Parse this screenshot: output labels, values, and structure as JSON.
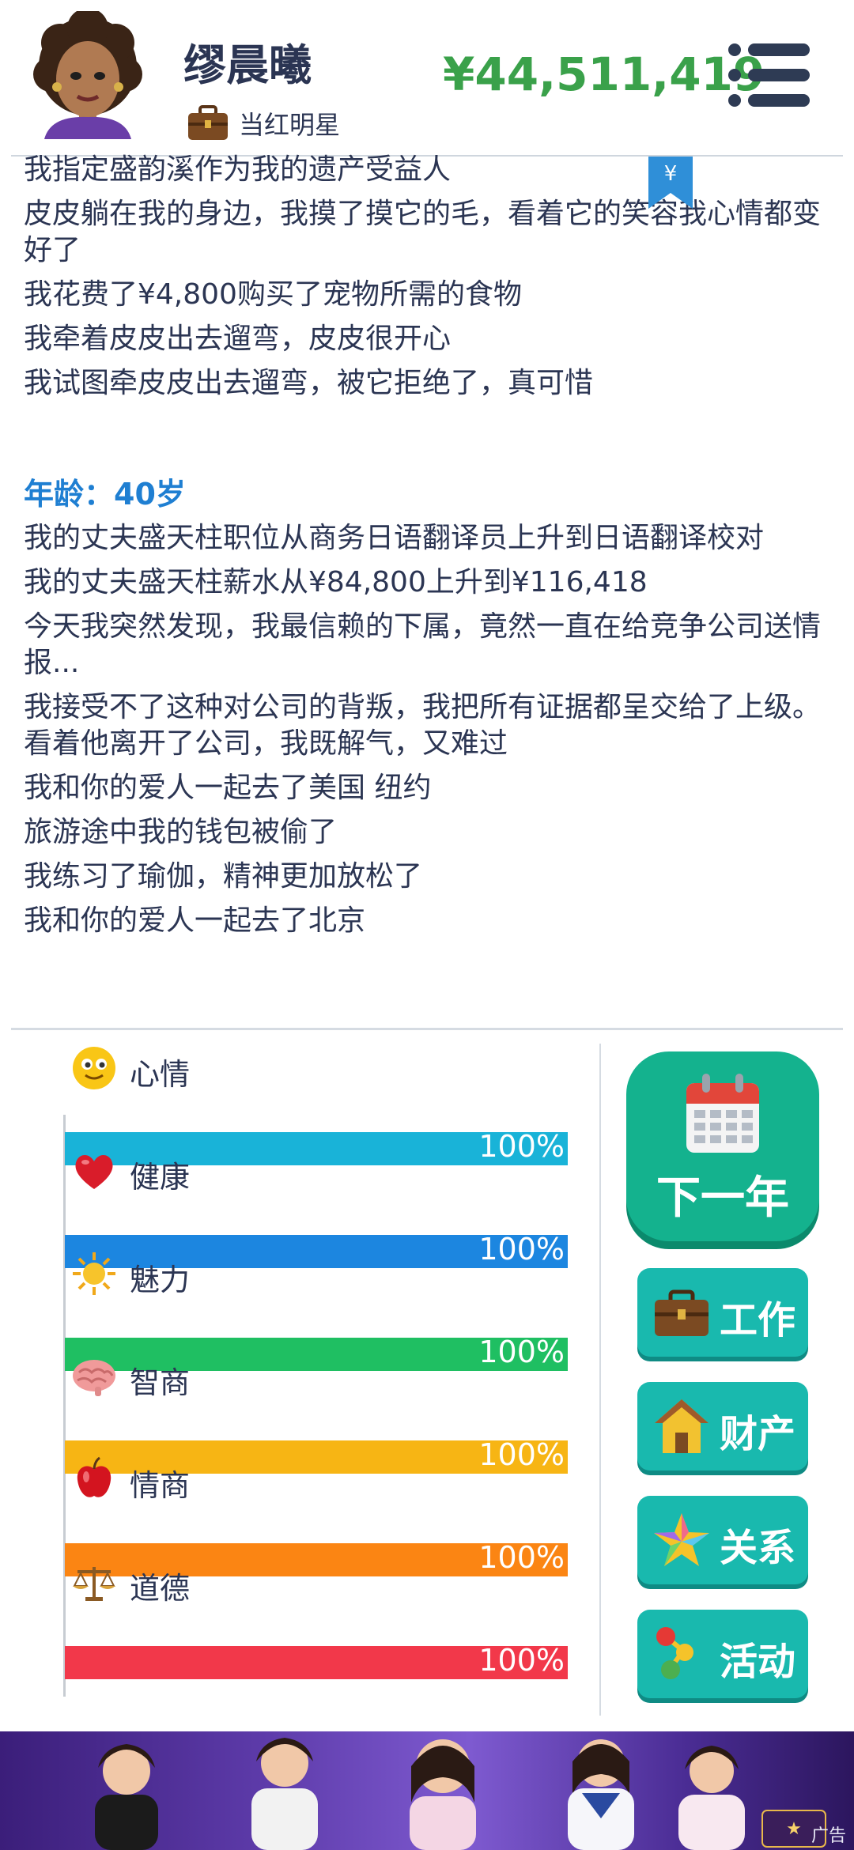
{
  "header": {
    "name": "缪晨曦",
    "job_title": "当红明星",
    "money": "¥44,511,419",
    "bookmark_symbol": "¥"
  },
  "log": {
    "lines_top": [
      "我指定盛韵溪作为我的遗产受益人",
      "皮皮躺在我的身边，我摸了摸它的毛，看着它的笑容我心情都变好了",
      "我花费了¥4,800购买了宠物所需的食物",
      "我牵着皮皮出去遛弯，皮皮很开心",
      "我试图牵皮皮出去遛弯，被它拒绝了，真可惜"
    ],
    "age_header": "年龄：40岁",
    "lines_age": [
      "我的丈夫盛天柱职位从商务日语翻译员上升到日语翻译校对",
      "我的丈夫盛天柱薪水从¥84,800上升到¥116,418",
      "今天我突然发现，我最信赖的下属，竟然一直在给竞争公司送情报...",
      "我接受不了这种对公司的背叛，我把所有证据都呈交给了上级。看着他离开了公司，我既解气，又难过",
      "我和你的爱人一起去了美国 纽约",
      "旅游途中我的钱包被偷了",
      "我练习了瑜伽，精神更加放松了",
      "我和你的爱人一起去了北京"
    ]
  },
  "stats": [
    {
      "label": "心情",
      "value": "100%",
      "level": 1.0,
      "color": "#19b3d8",
      "icon": "smiley-icon"
    },
    {
      "label": "健康",
      "value": "100%",
      "level": 1.0,
      "color": "#1c86e0",
      "icon": "heart-icon"
    },
    {
      "label": "魅力",
      "value": "100%",
      "level": 1.0,
      "color": "#1fbf62",
      "icon": "sun-icon"
    },
    {
      "label": "智商",
      "value": "100%",
      "level": 1.0,
      "color": "#f7b514",
      "icon": "brain-icon"
    },
    {
      "label": "情商",
      "value": "100%",
      "level": 1.0,
      "color": "#fb8513",
      "icon": "apple-icon"
    },
    {
      "label": "道德",
      "value": "100%",
      "level": 1.0,
      "color": "#f2384a",
      "icon": "scales-icon"
    }
  ],
  "actions": {
    "next_year": "下一年",
    "work": "工作",
    "assets": "财产",
    "relations": "关系",
    "activities": "活动"
  },
  "ad": {
    "tag": "广告"
  }
}
